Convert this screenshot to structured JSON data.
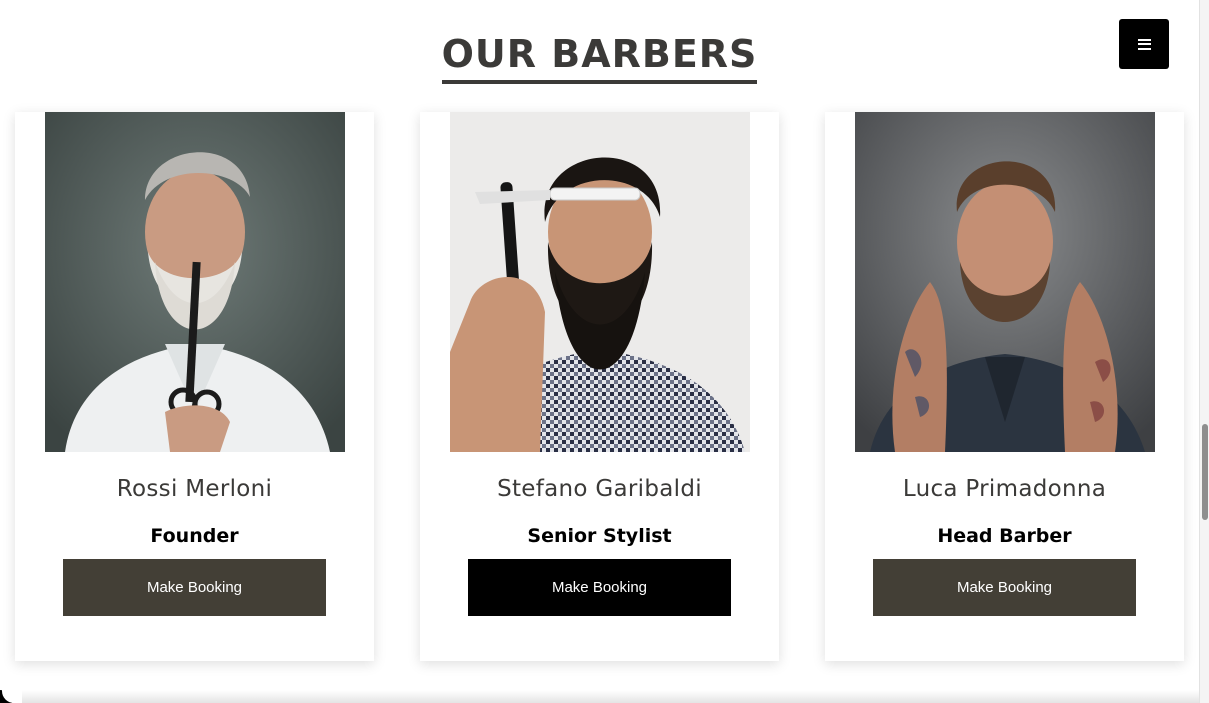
{
  "section": {
    "title": "OUR BARBERS"
  },
  "menu": {
    "icon": "hamburger-menu-icon"
  },
  "barbers": [
    {
      "name": "Rossi Merloni",
      "role": "Founder",
      "button": "Make Booking",
      "photo": "barber-portrait-grey-beard-scissors"
    },
    {
      "name": "Stefano Garibaldi",
      "role": "Senior Stylist",
      "button": "Make Booking",
      "photo": "barber-portrait-dark-beard-razor"
    },
    {
      "name": "Luca Primadonna",
      "role": "Head Barber",
      "button": "Make Booking",
      "photo": "barber-portrait-tattooed-twirling-moustache"
    }
  ],
  "colors": {
    "heading": "#3b3a38",
    "button": "#433f36",
    "button_hover": "#000000",
    "menu_button": "#000000"
  }
}
